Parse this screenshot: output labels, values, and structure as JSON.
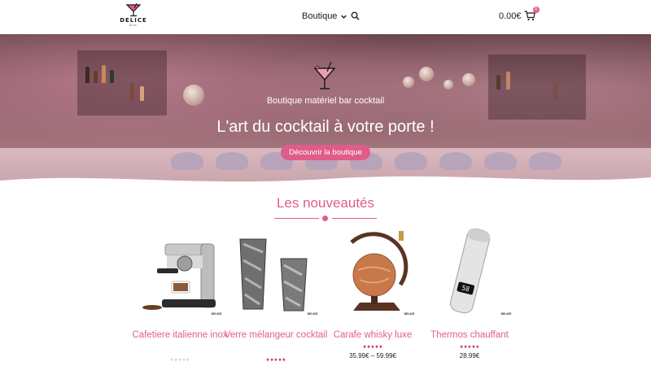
{
  "header": {
    "logo_text": "DELICE",
    "logo_sub": "BAR",
    "nav_label": "Boutique",
    "cart_total": "0.00€",
    "cart_count": "0"
  },
  "hero": {
    "subtitle": "Boutique matériel bar cocktail",
    "title": "L'art du cocktail à votre porte !",
    "cta_label": "Découvrir la boutique"
  },
  "section": {
    "title": "Les nouveautés"
  },
  "products": [
    {
      "name": "Cafetiere italienne inox",
      "rating": 0,
      "price": ""
    },
    {
      "name": "Verre mélangeur cocktail",
      "rating": 5,
      "price": ""
    },
    {
      "name": "Carafe whisky luxe",
      "rating": 5,
      "price": "35.99€ – 59.99€"
    },
    {
      "name": "Thermos chauffant",
      "rating": 5,
      "price": "28.99€"
    }
  ],
  "product_badge": "DELICE",
  "thermos_display": "58",
  "colors": {
    "accent": "#e05c8b",
    "star": "#c2185b"
  },
  "icons": [
    "cocktail-glass-icon",
    "chevron-down-icon",
    "search-icon",
    "cart-icon"
  ]
}
